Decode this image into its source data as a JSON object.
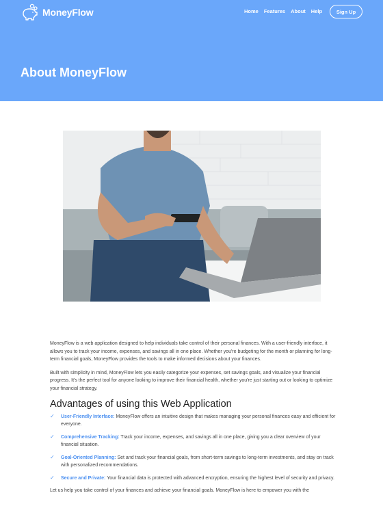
{
  "brand": {
    "name": "MoneyFlow",
    "logo_icon": "piggy-bank-icon"
  },
  "nav": {
    "items": [
      "Home",
      "Features",
      "About",
      "Help"
    ],
    "signup_label": "Sign Up"
  },
  "hero": {
    "title": "About MoneyFlow",
    "background_color": "#6aa7fa"
  },
  "photo": {
    "icon": "man-with-credit-card-and-laptop-photo"
  },
  "content": {
    "paragraphs": [
      "MoneyFlow is a web application designed to help individuals take control of their personal finances. With a user-friendly interface, it allows you to track your income, expenses, and savings all in one place. Whether you're budgeting for the month or planning for long-term financial goals, MoneyFlow provides the tools to make informed decisions about your finances.",
      "Built with simplicity in mind, MoneyFlow lets you easily categorize your expenses, set savings goals, and visualize your financial progress. It's the perfect tool for anyone looking to improve their financial health, whether you're just starting out or looking to optimize your financial strategy."
    ],
    "advantages_heading": "Advantages of using this Web Application",
    "advantages": [
      {
        "title": "User-Friendly Interface:",
        "text": "MoneyFlow offers an intuitive design that makes managing your personal finances easy and efficient for everyone."
      },
      {
        "title": "Comprehensive Tracking:",
        "text": "Track your income, expenses, and savings all in one place, giving you a clear overview of your financial situation."
      },
      {
        "title": "Goal-Oriented Planning:",
        "text": "Set and track your financial goals, from short-term savings to long-term investments, and stay on track with personalized recommendations."
      },
      {
        "title": "Secure and Private:",
        "text": "Your financial data is protected with advanced encryption, ensuring the highest level of security and privacy."
      }
    ],
    "closing": "Let us help you take control of your finances and achieve your financial goals. MoneyFlow is here to empower you with the"
  }
}
